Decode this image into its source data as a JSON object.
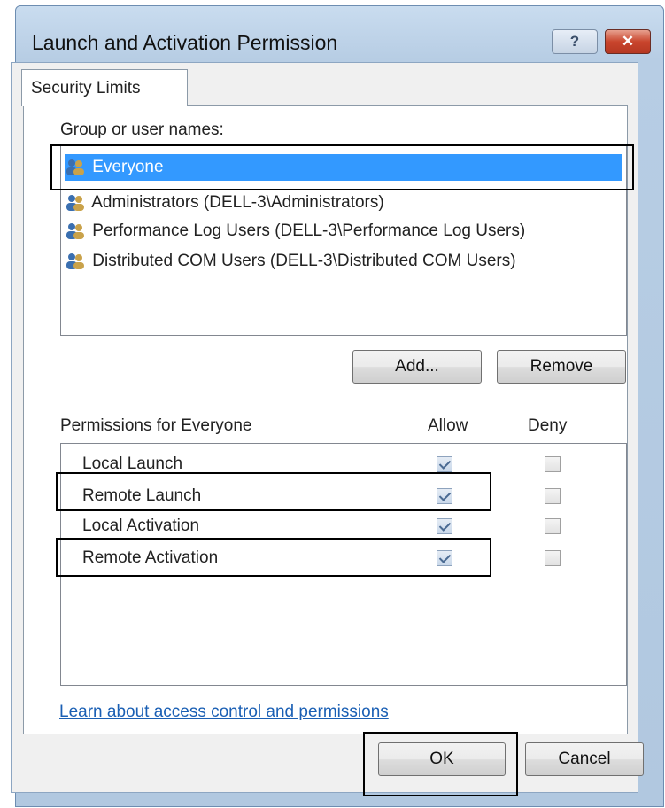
{
  "window": {
    "title": "Launch and Activation Permission",
    "help_label": "?",
    "close_label": "✕"
  },
  "tab": {
    "label": "Security Limits"
  },
  "groups": {
    "label": "Group or user names:",
    "items": [
      {
        "name": "Everyone",
        "selected": true,
        "icon": "users-icon"
      },
      {
        "name": "Administrators (DELL-3\\Administrators)",
        "selected": false,
        "icon": "users-icon"
      },
      {
        "name": "Performance Log Users (DELL-3\\Performance Log Users)",
        "selected": false,
        "icon": "users-icon"
      },
      {
        "name": "Distributed COM Users (DELL-3\\Distributed COM Users)",
        "selected": false,
        "icon": "users-icon"
      }
    ]
  },
  "buttons": {
    "add": "Add...",
    "remove": "Remove",
    "ok": "OK",
    "cancel": "Cancel"
  },
  "permissions": {
    "label": "Permissions for Everyone",
    "allow_header": "Allow",
    "deny_header": "Deny",
    "rows": [
      {
        "name": "Local Launch",
        "allow": true,
        "deny": false
      },
      {
        "name": "Remote Launch",
        "allow": true,
        "deny": false
      },
      {
        "name": "Local Activation",
        "allow": true,
        "deny": false
      },
      {
        "name": "Remote Activation",
        "allow": true,
        "deny": false
      }
    ]
  },
  "link": {
    "label": "Learn about access control and permissions"
  },
  "colors": {
    "selection": "#3399ff",
    "link": "#1a5fb4",
    "close_button": "#c9452d"
  }
}
